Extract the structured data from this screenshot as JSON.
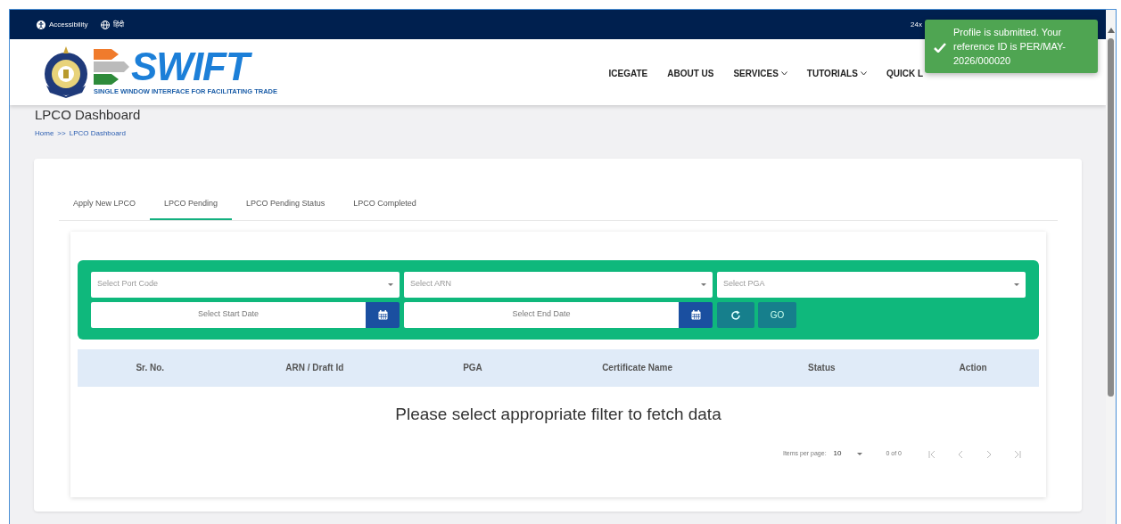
{
  "top_bar": {
    "links": [
      {
        "kind": "accessibility",
        "label": "Accessibility"
      },
      {
        "kind": "language",
        "label": "हिंदी"
      }
    ],
    "helpline": "24x"
  },
  "logo": {
    "wordmark": "SWIFT",
    "tagline": "SINGLE WINDOW INTERFACE FOR FACILITATING TRADE"
  },
  "nav": [
    {
      "label": "ICEGATE",
      "dropdown": false
    },
    {
      "label": "ABOUT US",
      "dropdown": false
    },
    {
      "label": "SERVICES",
      "dropdown": true
    },
    {
      "label": "TUTORIALS",
      "dropdown": true
    },
    {
      "label": "QUICK L",
      "dropdown": false
    }
  ],
  "toast": {
    "message": "Profile is submitted. Your reference ID is PER/MAY-2026/000020"
  },
  "page_title": "LPCO Dashboard",
  "breadcrumb": {
    "items": [
      "Home",
      "LPCO Dashboard"
    ],
    "separator": ">>"
  },
  "tabs": [
    {
      "label": "Apply New LPCO",
      "selected": false
    },
    {
      "label": "LPCO Pending",
      "selected": true
    },
    {
      "label": "LPCO Pending Status",
      "selected": false
    },
    {
      "label": "LPCO Completed",
      "selected": false
    }
  ],
  "filters": {
    "selects": [
      {
        "placeholder": "Select Port Code"
      },
      {
        "placeholder": "Select ARN"
      },
      {
        "placeholder": "Select PGA"
      }
    ],
    "dates": [
      {
        "placeholder": "Select Start Date"
      },
      {
        "placeholder": "Select End Date"
      }
    ],
    "go": "GO"
  },
  "table": {
    "columns": [
      "Sr. No.",
      "ARN / Draft Id",
      "PGA",
      "Certificate Name",
      "Status",
      "Action"
    ],
    "empty_message": "Please select appropriate filter to fetch data"
  },
  "paginator": {
    "label": "Items per page:",
    "page_size": "10",
    "range": "0 of 0"
  }
}
